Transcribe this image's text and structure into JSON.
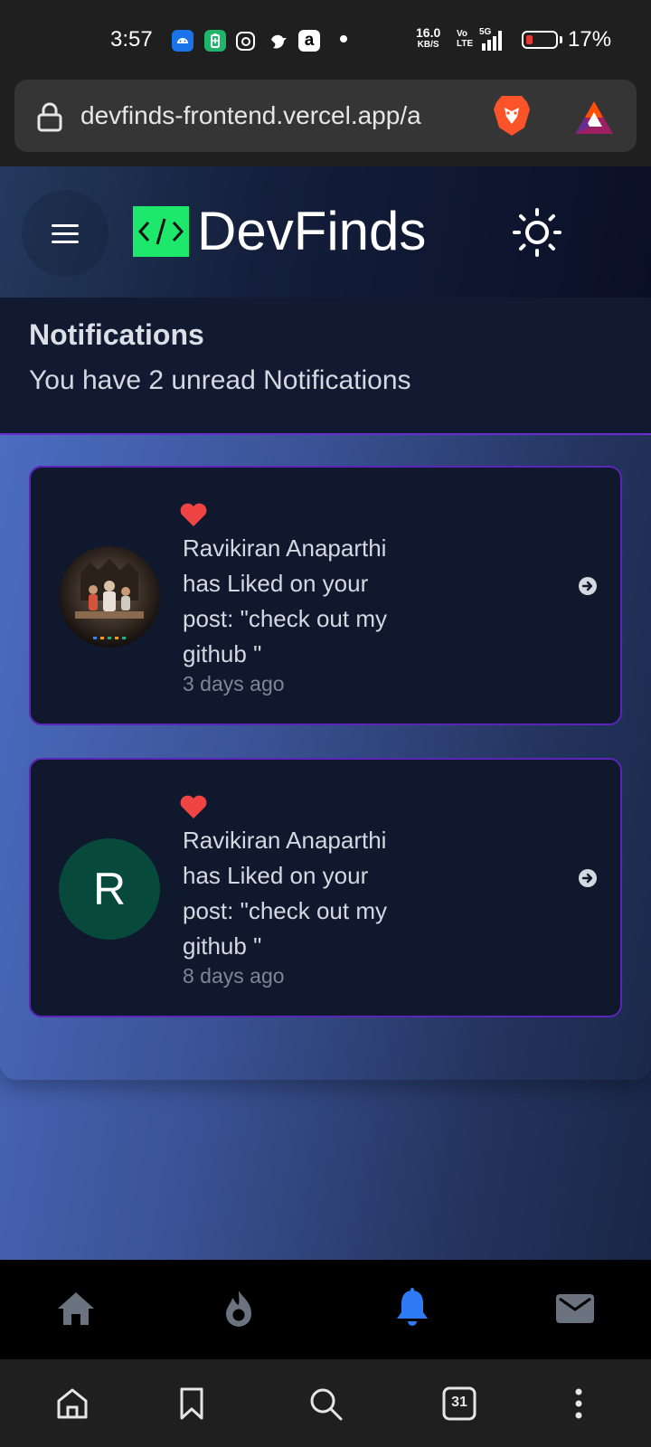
{
  "status_bar": {
    "time": "3:57",
    "net_speed_value": "16.0",
    "net_speed_unit": "KB/S",
    "volte_top": "Vo",
    "volte_bottom": "LTE",
    "signal_label": "5G",
    "battery_percent": "17%",
    "battery_level": 0.17,
    "notification_icons": [
      "android-icon",
      "battery-saver-icon",
      "instagram-icon",
      "bird-icon",
      "amazon-icon",
      "more-dot-icon"
    ]
  },
  "browser": {
    "url": "devfinds-frontend.vercel.app/a",
    "tab_count": "31"
  },
  "app": {
    "name": "DevFinds",
    "accent_color": "#1ee86c",
    "active_nav_color": "#2f7bf5"
  },
  "notifications": {
    "title": "Notifications",
    "subtitle": "You have 2 unread Notifications",
    "items": [
      {
        "avatar_type": "photo",
        "avatar_letter": "",
        "text": "Ravikiran Anaparthi has Liked on your post: \"check out my github \"",
        "time": "3 days ago"
      },
      {
        "avatar_type": "letter",
        "avatar_letter": "R",
        "text": "Ravikiran Anaparthi has Liked on your post: \"check out my github \"",
        "time": "8 days ago"
      }
    ]
  },
  "app_nav": [
    "home-icon",
    "fire-icon",
    "bell-icon",
    "mail-icon"
  ],
  "browser_nav": [
    "home-icon",
    "bookmark-icon",
    "search-icon",
    "tabs-icon",
    "more-vertical-icon"
  ]
}
